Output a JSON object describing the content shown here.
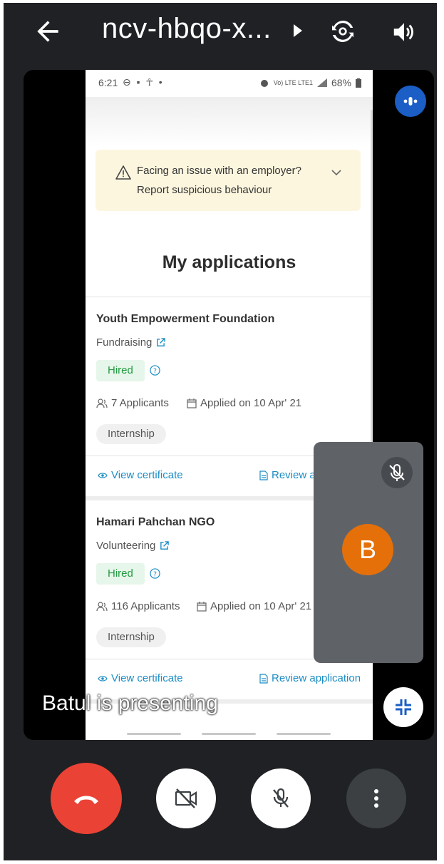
{
  "topbar": {
    "meeting_code": "ncv-hbqo-x...",
    "back_icon": "arrow-left-icon",
    "switch_camera_icon": "switch-camera-icon",
    "speaker_icon": "speaker-icon"
  },
  "phone_status": {
    "time": "6:21",
    "left_icons": "⊖ ▪ ☥ •",
    "network": "Vo) LTE LTE1",
    "battery": "68%"
  },
  "alert": {
    "line1": "Facing an issue with an employer?",
    "line2": "Report suspicious behaviour"
  },
  "page_title": "My applications",
  "applications": [
    {
      "org": "Youth Empowerment Foundation",
      "category": "Fundraising",
      "status": "Hired",
      "applicants": "7 Applicants",
      "applied": "Applied on 10 Apr' 21",
      "type": "Internship",
      "link1": "View certificate",
      "link2": "Review a"
    },
    {
      "org": "Hamari Pahchan NGO",
      "category": "Volunteering",
      "status": "Hired",
      "applicants": "116 Applicants",
      "applied": "Applied on 10 Apr' 21",
      "type": "Internship",
      "link1": "View certificate",
      "link2": "Review application"
    }
  ],
  "presenting_label": "Batul is presenting",
  "self_tile": {
    "avatar_initial": "B"
  },
  "colors": {
    "end_call": "#ea4335",
    "avatar": "#e5700a",
    "link": "#1c8dc4",
    "hired": "#239a41"
  }
}
